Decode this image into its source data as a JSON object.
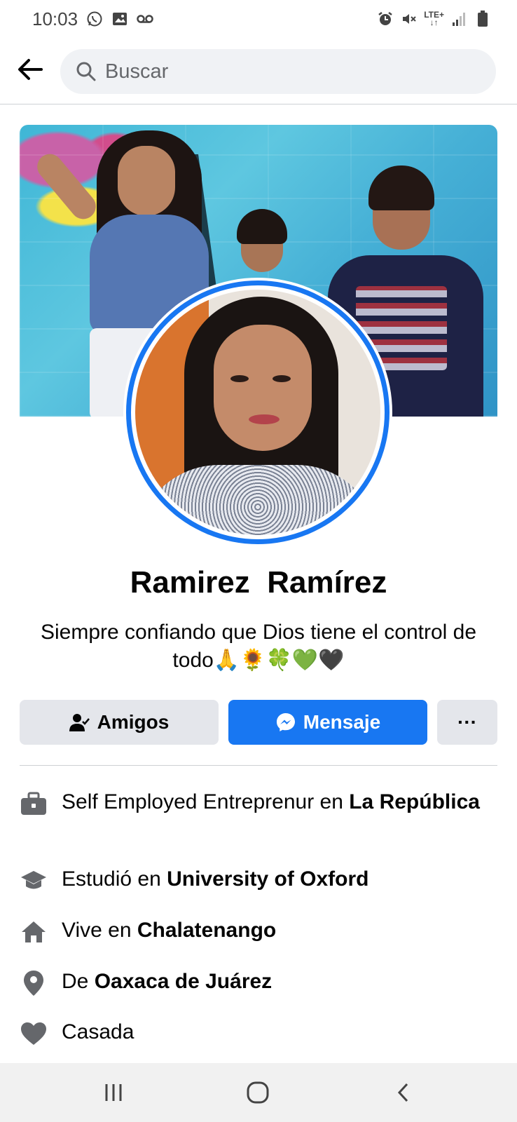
{
  "status_bar": {
    "time": "10:03",
    "left_icons": [
      "whatsapp-icon",
      "image-icon",
      "voicemail-icon"
    ],
    "right_icons": [
      "alarm-icon",
      "mute-icon",
      "lte-icon",
      "signal-icon",
      "battery-icon"
    ],
    "network": "LTE+"
  },
  "header": {
    "search_placeholder": "Buscar"
  },
  "profile": {
    "name": "Ramirez  Ramírez",
    "bio": "Siempre confiando que Dios tiene el control de todo🙏🌻🍀💚🖤"
  },
  "actions": {
    "friends_label": "Amigos",
    "message_label": "Mensaje",
    "more_label": "···"
  },
  "details": [
    {
      "icon": "briefcase-icon",
      "prefix": "Self Employed Entreprenur en ",
      "value": "La República"
    },
    {
      "icon": "graduation-cap-icon",
      "prefix": "Estudió en ",
      "value": "University of Oxford"
    },
    {
      "icon": "home-icon",
      "prefix": "Vive en ",
      "value": "Chalatenango"
    },
    {
      "icon": "location-pin-icon",
      "prefix": "De ",
      "value": "Oaxaca de Juárez"
    },
    {
      "icon": "heart-icon",
      "prefix": "Casada",
      "value": ""
    }
  ],
  "colors": {
    "accent": "#1877f2",
    "button_gray": "#e4e6eb",
    "search_bg": "#f0f2f5",
    "icon_gray": "#65676b"
  }
}
